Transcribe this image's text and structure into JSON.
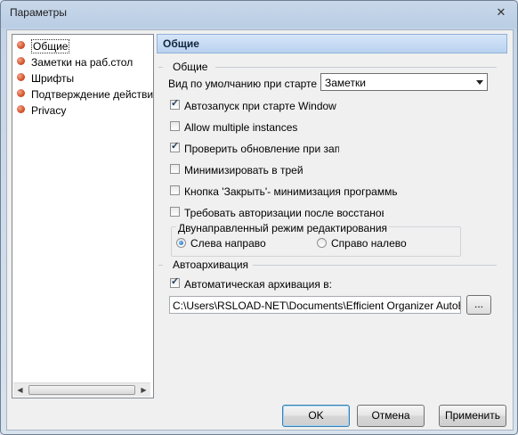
{
  "window": {
    "title": "Параметры",
    "close_glyph": "✕"
  },
  "sidebar": {
    "items": [
      {
        "label": "Общие"
      },
      {
        "label": "Заметки на раб.стол"
      },
      {
        "label": "Шрифты"
      },
      {
        "label": "Подтверждение действий"
      },
      {
        "label": "Privacy"
      }
    ],
    "selected_index": 0,
    "scroll_left_glyph": "◀",
    "scroll_right_glyph": "▶"
  },
  "section": {
    "header": "Общие"
  },
  "general": {
    "group_title": "Общие",
    "default_view_label": "Вид по умолчанию при старте",
    "default_view_value": "Заметки",
    "checkboxes": [
      {
        "label": "Автозапуск при старте Window",
        "checked": true
      },
      {
        "label": "Allow multiple instances",
        "checked": false
      },
      {
        "label": "Проверить обновление при запуске",
        "checked": true
      },
      {
        "label": "Минимизировать в трей",
        "checked": false
      },
      {
        "label": "Кнопка 'Закрыть'- минимизация программы",
        "checked": false
      },
      {
        "label": "Требовать авторизации после восстановления",
        "checked": false
      }
    ],
    "bidi_group_title": "Двунаправленный режим редактирования",
    "radios": [
      {
        "label": "Слева направо",
        "selected": true
      },
      {
        "label": "Справо налево",
        "selected": false
      }
    ]
  },
  "archive": {
    "group_title": "Автоархивация",
    "auto_archive_label": "Автоматическая архивация в:",
    "auto_archive_checked": true,
    "path_value": "C:\\Users\\RSLOAD-NET\\Documents\\Efficient Organizer AutoBackup",
    "browse_label": "..."
  },
  "buttons": {
    "ok": "OK",
    "cancel": "Отмена",
    "apply": "Применить"
  }
}
